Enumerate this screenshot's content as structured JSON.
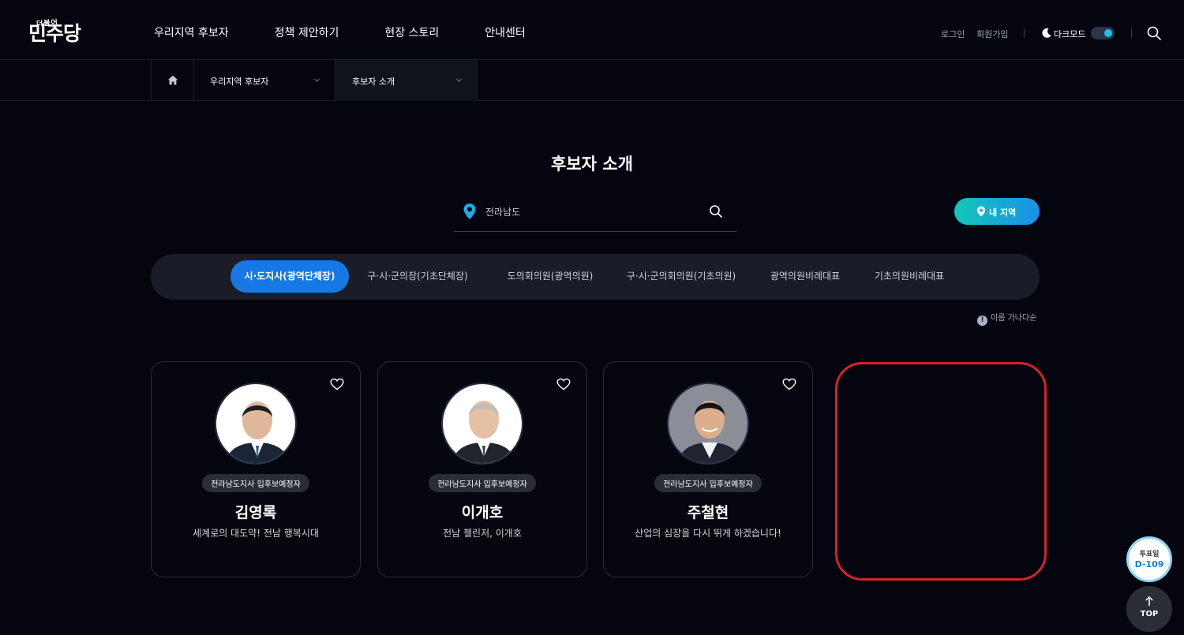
{
  "header": {
    "logo": {
      "small": "더불어",
      "main": "민주당"
    },
    "nav": [
      "우리지역 후보자",
      "정책 제안하기",
      "현장 스토리",
      "안내센터"
    ],
    "login": "로그인",
    "join": "회원가입",
    "dark_mode_label": "다크모드",
    "dark_mode_on": true,
    "accent_color": "#18c3ee"
  },
  "breadcrumb": {
    "level1": "우리지역 후보자",
    "level2": "후보자 소개"
  },
  "page_title": "후보자 소개",
  "search": {
    "value": "전라남도",
    "placeholder": "전라남도"
  },
  "my_region_button": "내 지역",
  "tabs": [
    "시·도지사(광역단체장)",
    "구·시·군의장(기초단체장)",
    "도의회의원(광역의원)",
    "구·시·군의회의원(기초의원)",
    "광역의원비례대표",
    "기초의원비례대표"
  ],
  "active_tab_index": 0,
  "sort_note": "이름 가나다순",
  "candidates": [
    {
      "role": "전라남도지사 입후보예정자",
      "name": "김영록",
      "slogan": "세계로의 대도약! 전남 행복시대"
    },
    {
      "role": "전라남도지사 입후보예정자",
      "name": "이개호",
      "slogan": "전남 첼린저, 이개호"
    },
    {
      "role": "전라남도지사 입후보예정자",
      "name": "주철현",
      "slogan": "산업의 심장을 다시 뛰게 하겠습니다!"
    }
  ],
  "dday": {
    "label": "투표일",
    "value": "D-109"
  },
  "top_button": "TOP"
}
